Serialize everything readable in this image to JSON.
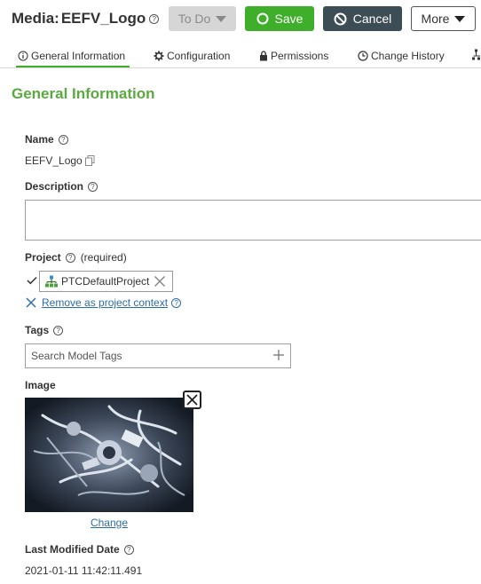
{
  "header": {
    "title_prefix": "Media:",
    "title_name": "EEFV_Logo",
    "buttons": {
      "todo": "To Do",
      "save": "Save",
      "cancel": "Cancel",
      "more": "More"
    }
  },
  "tabs": [
    {
      "label": "General Information",
      "icon": "info-icon",
      "active": true
    },
    {
      "label": "Configuration",
      "icon": "gear-icon",
      "active": false
    },
    {
      "label": "Permissions",
      "icon": "lock-icon",
      "active": false
    },
    {
      "label": "Change History",
      "icon": "clock-icon",
      "active": false
    }
  ],
  "section_title": "General Information",
  "fields": {
    "name": {
      "label": "Name",
      "value": "EEFV_Logo"
    },
    "description": {
      "label": "Description",
      "value": ""
    },
    "project": {
      "label": "Project",
      "required_note": "(required)",
      "value": "PTCDefaultProject",
      "remove_link": "Remove as project context"
    },
    "tags": {
      "label": "Tags",
      "placeholder": "Search Model Tags"
    },
    "image": {
      "label": "Image",
      "change_link": "Change"
    },
    "last_modified": {
      "label": "Last Modified Date",
      "value": "2021-01-11 11:42:11.491"
    }
  },
  "colors": {
    "accent_green": "#3fae2a",
    "section_green": "#5ba941",
    "cancel_bg": "#3d4d55",
    "link_blue": "#2b6da8"
  }
}
